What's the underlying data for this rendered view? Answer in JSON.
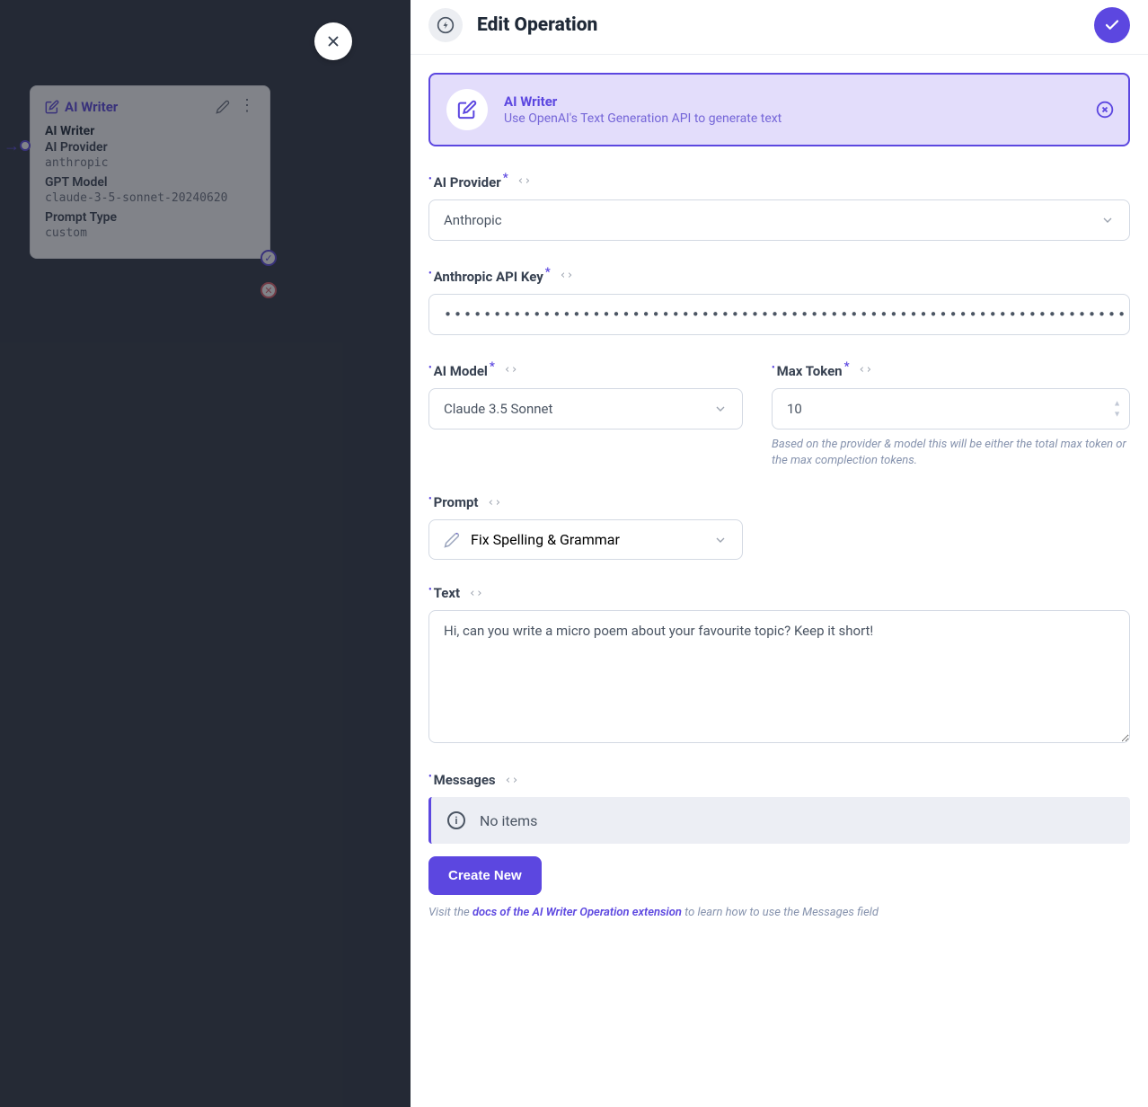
{
  "bg_card": {
    "title": "AI Writer",
    "field1_label": "AI Writer",
    "field2_label": "AI Provider",
    "field2_value": "anthropic",
    "field3_label": "GPT Model",
    "field3_value": "claude-3-5-sonnet-20240620",
    "field4_label": "Prompt Type",
    "field4_value": "custom"
  },
  "drawer": {
    "title": "Edit Operation",
    "banner": {
      "title": "AI Writer",
      "desc": "Use OpenAI's Text Generation API to generate text"
    },
    "fields": {
      "ai_provider": {
        "label": "AI Provider",
        "value": "Anthropic"
      },
      "api_key": {
        "label": "Anthropic API Key",
        "value": "••••••••••••••••••••••••••••••••••••••••••••••••••••••••••••••••••••••••••••••••••••••••••••••••••••••••••"
      },
      "ai_model": {
        "label": "AI Model",
        "value": "Claude 3.5 Sonnet"
      },
      "max_token": {
        "label": "Max Token",
        "value": "10",
        "help": "Based on the provider & model this will be either the total max token or the max complection tokens."
      },
      "prompt": {
        "label": "Prompt",
        "value": "Fix Spelling & Grammar"
      },
      "text": {
        "label": "Text",
        "value": "Hi, can you write a micro poem about your favourite topic? Keep it short!"
      },
      "messages": {
        "label": "Messages",
        "no_items": "No items",
        "create_new": "Create New",
        "help_prefix": "Visit the ",
        "help_link": "docs of the AI Writer Operation extension",
        "help_suffix": " to learn how to use the Messages field"
      }
    }
  }
}
